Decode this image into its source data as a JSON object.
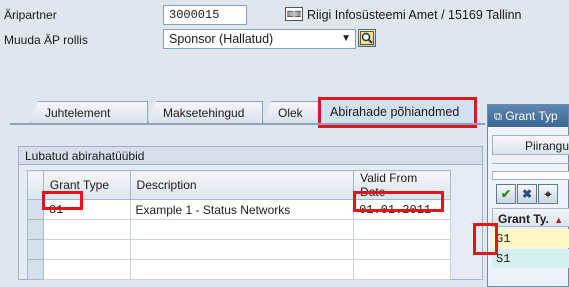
{
  "header": {
    "partner_label": "Äripartner",
    "partner_value": "3000015",
    "partner_name": "Riigi Infosüsteemi Amet / 15169 Tallinn",
    "role_label": "Muuda ÄP rollis",
    "role_value": "Sponsor (Hallatud)"
  },
  "tabs": [
    {
      "label": "Juhtelement"
    },
    {
      "label": "Maksetehingud"
    },
    {
      "label": "Olek"
    },
    {
      "label": "Abirahade põhiandmed"
    }
  ],
  "group": {
    "title": "Lubatud abirahatüübid",
    "columns": [
      "Grant Type",
      "Description",
      "Valid From Date"
    ],
    "rows": [
      {
        "grant_type": "G1",
        "description": "Example 1 - Status Networks",
        "valid_from": "01.01.2011"
      }
    ]
  },
  "popup": {
    "title": "Grant Typ",
    "tab_label": "Piirangu",
    "column_header": "Grant Ty.",
    "items": [
      "G1",
      "S1"
    ]
  },
  "colors": {
    "highlight": "#e0161e",
    "background": "#dfe6ee",
    "popup_title": "#3d6796",
    "selected_row": "#fff8c4",
    "second_row": "#d6f0ee"
  }
}
